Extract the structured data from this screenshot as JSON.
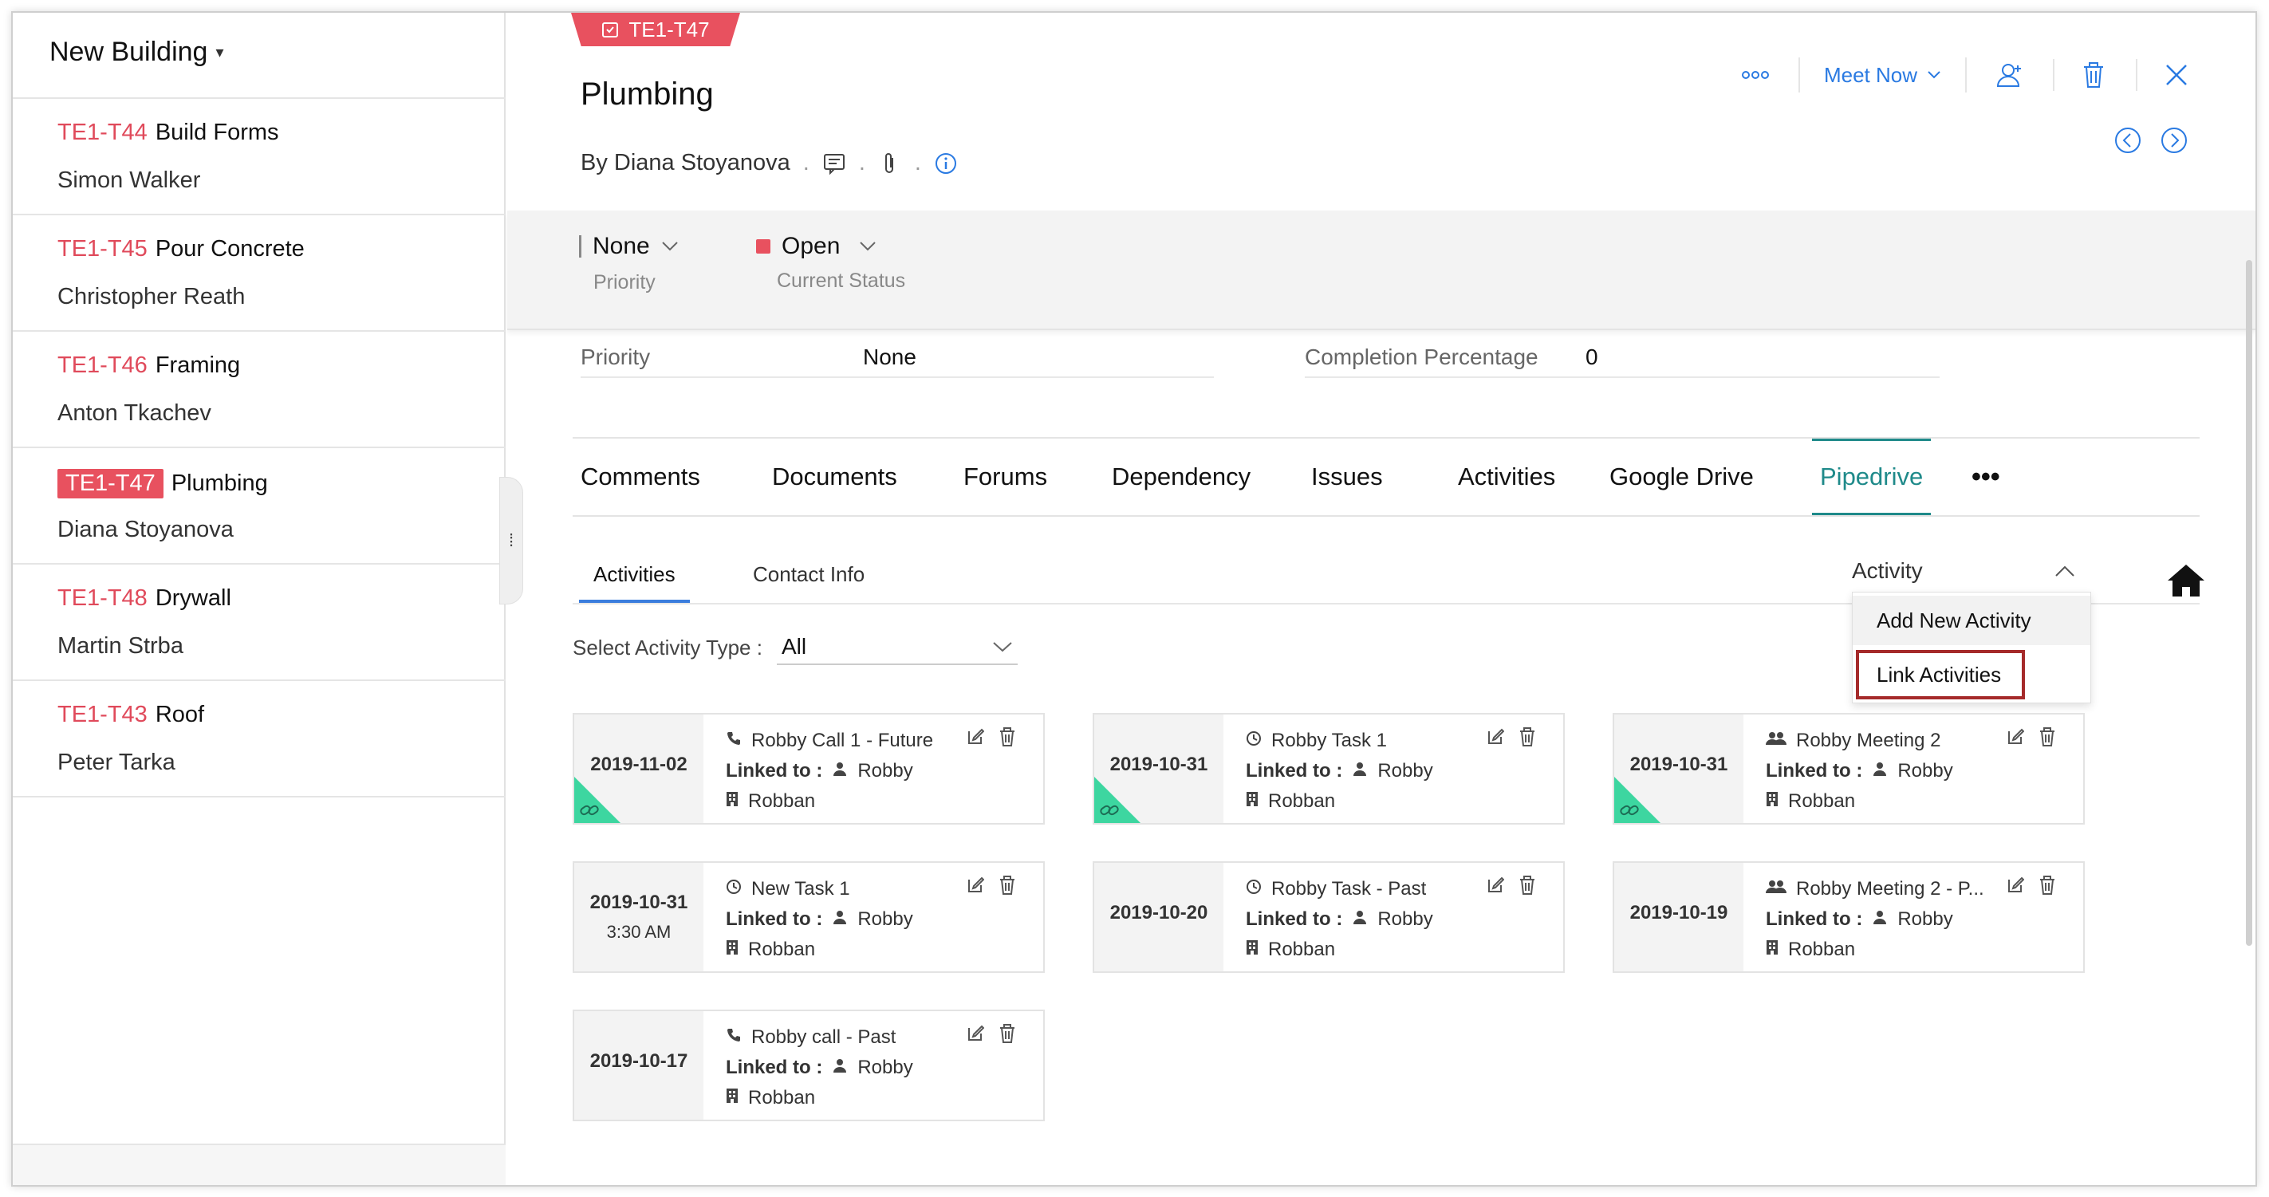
{
  "sidebar": {
    "project_title": "New Building",
    "tasks": [
      {
        "id": "TE1-T44",
        "name": "Build Forms",
        "owner": "Simon Walker"
      },
      {
        "id": "TE1-T45",
        "name": "Pour Concrete",
        "owner": "Christopher Reath"
      },
      {
        "id": "TE1-T46",
        "name": "Framing",
        "owner": "Anton Tkachev"
      },
      {
        "id": "TE1-T47",
        "name": "Plumbing",
        "owner": "Diana Stoyanova"
      },
      {
        "id": "TE1-T48",
        "name": "Drywall",
        "owner": "Martin Strba"
      },
      {
        "id": "TE1-T43",
        "name": "Roof",
        "owner": "Peter Tarka"
      }
    ]
  },
  "task": {
    "tag": "TE1-T47",
    "title": "Plumbing",
    "by_prefix": "By",
    "by_name": "Diana Stoyanova"
  },
  "top_actions": {
    "meet_now": "Meet Now"
  },
  "status_band": {
    "priority_value": "None",
    "priority_label": "Priority",
    "status_value": "Open",
    "status_label": "Current Status",
    "status_color": "#e8515f"
  },
  "fields": {
    "priority_label": "Priority",
    "priority_value": "None",
    "completion_label": "Completion Percentage",
    "completion_value": "0"
  },
  "tabs": [
    "Comments",
    "Documents",
    "Forums",
    "Dependency",
    "Issues",
    "Activities",
    "Google Drive",
    "Pipedrive"
  ],
  "active_tab": "Pipedrive",
  "subtabs": [
    "Activities",
    "Contact Info"
  ],
  "activity_dropdown": {
    "label": "Activity",
    "items": [
      "Add New Activity",
      "Link Activities"
    ]
  },
  "filter": {
    "label": "Select Activity Type :",
    "value": "All"
  },
  "cards": [
    {
      "date": "2019-11-02",
      "time": "",
      "type": "call",
      "title": "Robby Call 1 - Future",
      "linked_label": "Linked to :",
      "person": "Robby",
      "org": "Robban",
      "linked": true
    },
    {
      "date": "2019-10-31",
      "time": "",
      "type": "task",
      "title": "Robby Task 1",
      "linked_label": "Linked to :",
      "person": "Robby",
      "org": "Robban",
      "linked": true
    },
    {
      "date": "2019-10-31",
      "time": "",
      "type": "meeting",
      "title": "Robby Meeting 2",
      "linked_label": "Linked to :",
      "person": "Robby",
      "org": "Robban",
      "linked": true
    },
    {
      "date": "2019-10-31",
      "time": "3:30 AM",
      "type": "task",
      "title": "New Task 1",
      "linked_label": "Linked to :",
      "person": "Robby",
      "org": "Robban",
      "linked": false
    },
    {
      "date": "2019-10-20",
      "time": "",
      "type": "task",
      "title": "Robby Task - Past",
      "linked_label": "Linked to :",
      "person": "Robby",
      "org": "Robban",
      "linked": false
    },
    {
      "date": "2019-10-19",
      "time": "",
      "type": "meeting",
      "title": "Robby Meeting 2 - P...",
      "linked_label": "Linked to :",
      "person": "Robby",
      "org": "Robban",
      "linked": false
    },
    {
      "date": "2019-10-17",
      "time": "",
      "type": "call",
      "title": "Robby call - Past",
      "linked_label": "Linked to :",
      "person": "Robby",
      "org": "Robban",
      "linked": false
    }
  ],
  "colors": {
    "accent": "#1f8a8a",
    "link_blue": "#2a7ae2",
    "task_red": "#e8515f",
    "linked_green": "#3dd6a0"
  }
}
